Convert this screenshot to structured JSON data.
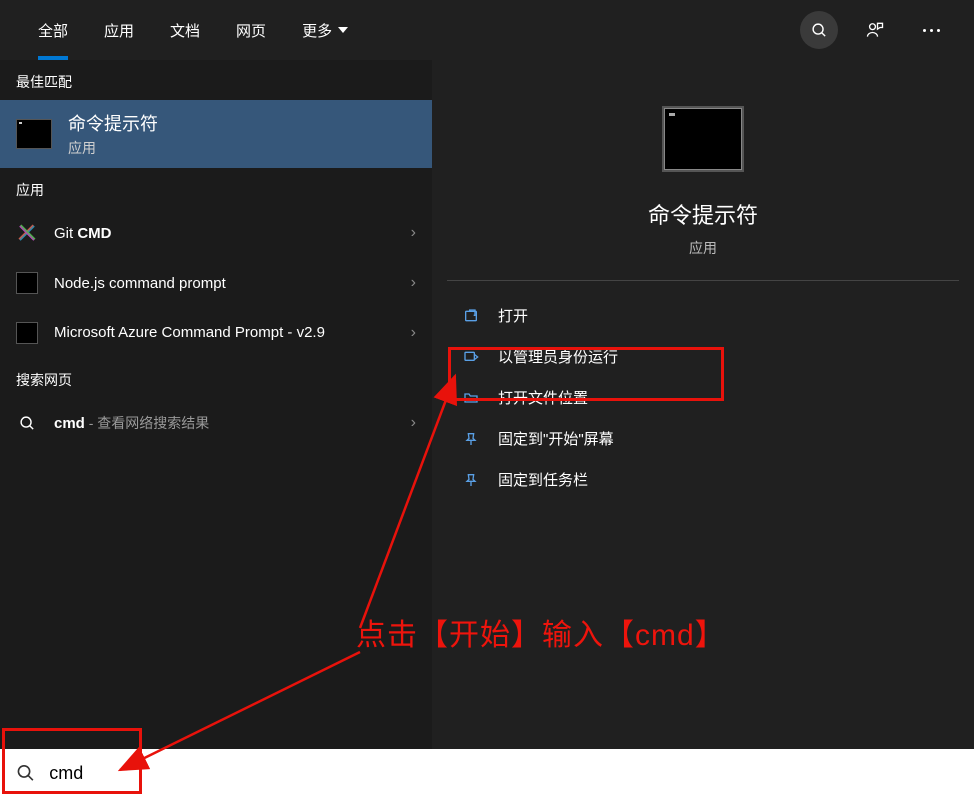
{
  "topbar": {
    "tabs": [
      "全部",
      "应用",
      "文档",
      "网页",
      "更多"
    ]
  },
  "left": {
    "best_match_header": "最佳匹配",
    "best_match": {
      "title": "命令提示符",
      "subtitle": "应用"
    },
    "apps_header": "应用",
    "apps": [
      {
        "prefix": "Git ",
        "bold": "CMD"
      },
      {
        "label": "Node.js command prompt"
      },
      {
        "label": "Microsoft Azure Command Prompt - v2.9"
      }
    ],
    "web_header": "搜索网页",
    "web": {
      "bold": "cmd",
      "suffix": " - 查看网络搜索结果"
    }
  },
  "right": {
    "title": "命令提示符",
    "subtitle": "应用",
    "actions": [
      "打开",
      "以管理员身份运行",
      "打开文件位置",
      "固定到\"开始\"屏幕",
      "固定到任务栏"
    ]
  },
  "search": {
    "value": "cmd"
  },
  "annotation": {
    "text": "点击【开始】输入【cmd】"
  }
}
